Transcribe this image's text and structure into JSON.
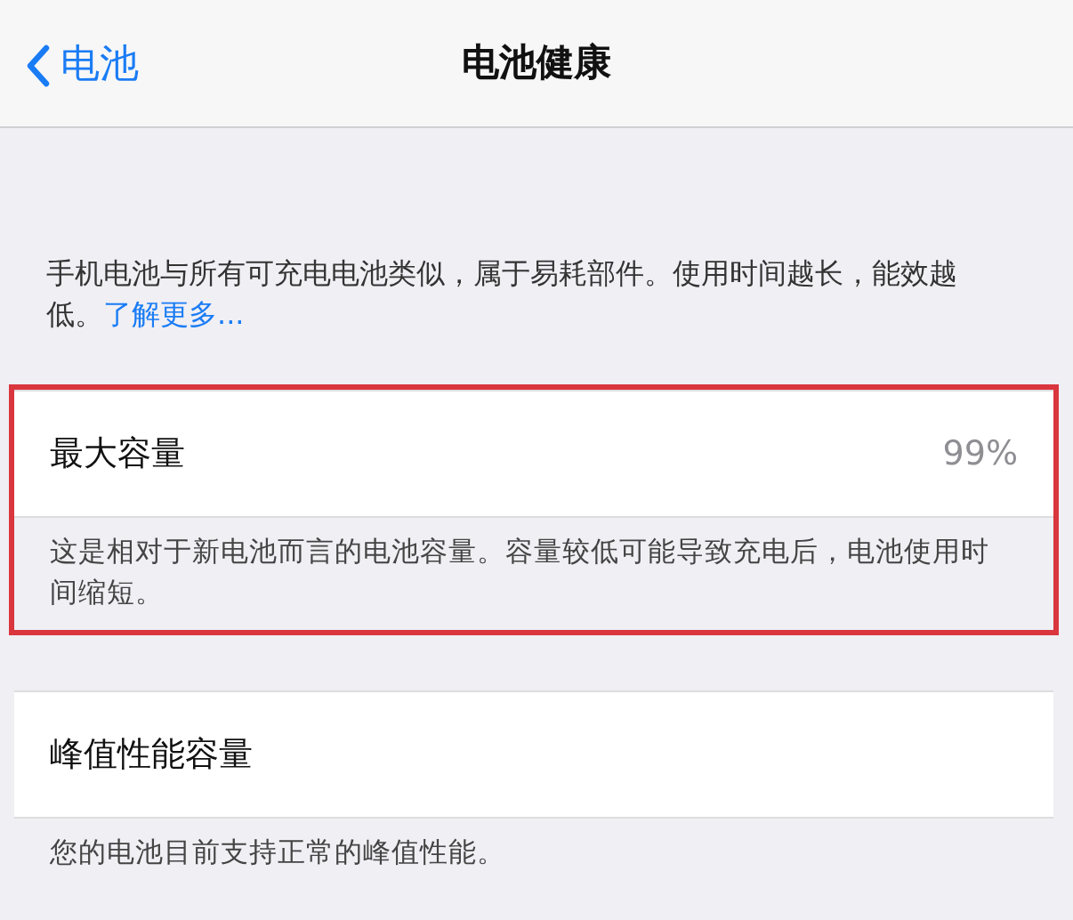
{
  "nav_bar": {
    "back_label": "电池",
    "title": "电池健康"
  },
  "intro": {
    "text": "手机电池与所有可充电电池类似，属于易耗部件。使用时间越长，能效越低。",
    "link": "了解更多..."
  },
  "sections": [
    {
      "label": "最大容量",
      "value": "99%",
      "footer": "这是相对于新电池而言的电池容量。容量较低可能导致充电后，电池使用时间缩短。",
      "highlighted": true
    },
    {
      "label": "峰值性能容量",
      "footer": "您的电池目前支持正常的峰值性能。",
      "highlighted": false
    }
  ]
}
